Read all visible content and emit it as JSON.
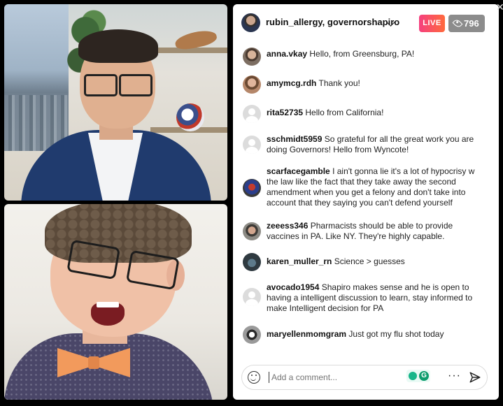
{
  "header": {
    "title": "rubin_allergy, governorshapiro",
    "live_label": "LIVE",
    "viewer_count": "796"
  },
  "comments": [
    {
      "user": "anna.vkay",
      "text": "Hello, from Greensburg, PA!"
    },
    {
      "user": "amymcg.rdh",
      "text": "Thank you!"
    },
    {
      "user": "rita52735",
      "text": "Hello from California!"
    },
    {
      "user": "sschmidt5959",
      "text": "So grateful for all the great work you are doing Governors! Hello from Wyncote!"
    },
    {
      "user": "scarfacegamble",
      "text": "I ain't gonna lie it's a lot of hypocrisy w the law like the fact that they take away the second amendment when you get a felony and don't take into account that they saying you can't defend yourself"
    },
    {
      "user": "zeeess346",
      "text": "Pharmacists should be able to provide vaccines in PA. Like NY. They're highly capable."
    },
    {
      "user": "karen_muller_rn",
      "text": "Science > guesses"
    },
    {
      "user": "avocado1954",
      "text": "Shapiro makes sense and he is open to having a intelligent discussion to learn, stay informed to make Intelligent decision for PA"
    },
    {
      "user": "maryellenmomgram",
      "text": "Just got my flu shot today"
    }
  ],
  "input": {
    "placeholder": "Add a comment...",
    "more_label": "···"
  },
  "close_glyph": "✕",
  "colors": {
    "live_gradient_start": "#f5407f",
    "live_gradient_end": "#ff6a3d",
    "viewer_badge": "#8c8c8c"
  }
}
